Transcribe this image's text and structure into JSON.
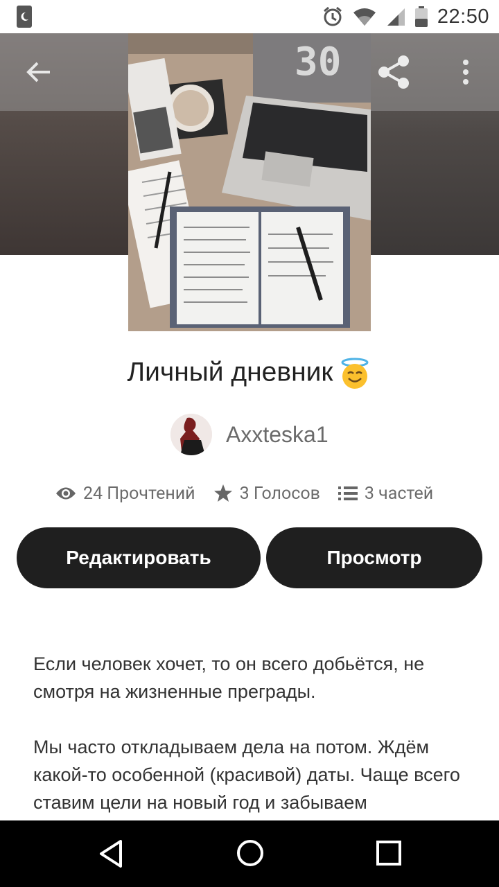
{
  "status_bar": {
    "time": "22:50",
    "icons": [
      "moon-icon",
      "alarm-icon",
      "wifi-icon",
      "signal-icon",
      "battery-icon"
    ]
  },
  "toolbar": {
    "back_icon": "arrow-left-icon",
    "share_icon": "share-icon",
    "more_icon": "more-vertical-icon"
  },
  "story": {
    "title": "Личный дневник",
    "title_emoji": "smiling-face-with-halo",
    "author": "Axxteska1",
    "stats": {
      "reads": "24 Прочтений",
      "votes": "3 Голосов",
      "parts": "3 частей"
    }
  },
  "buttons": {
    "edit": "Редактировать",
    "view": "Просмотр"
  },
  "description": {
    "p1": "Если человек хочет, то он всего добьётся, не смотря на жизненные преграды.",
    "p2": "Мы часто откладываем дела на потом. Ждём какой-то особенной (красивой) даты. Чаще всего ставим цели на новый год и забываем"
  },
  "colors": {
    "button_bg": "#1f1f1f",
    "button_text": "#ffffff",
    "stats_text": "#6b6b6b"
  },
  "navbar": {
    "icons": [
      "nav-back-icon",
      "nav-home-icon",
      "nav-recents-icon"
    ]
  }
}
